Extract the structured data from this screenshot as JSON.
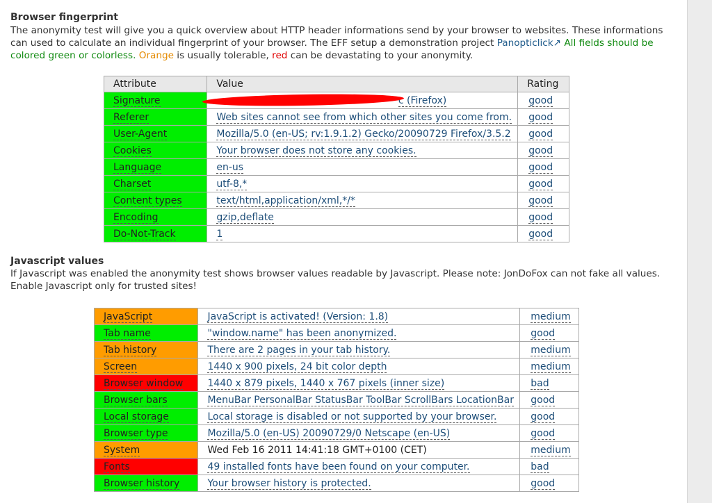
{
  "page": {
    "top_fragment": "· · · ·  ·  ·"
  },
  "fingerprint": {
    "heading": "Browser fingerprint",
    "intro_1": "The anonymity test will give you a quick overview about HTTP header informations send by your browser to websites. These informations can used to calculate an individual fingerprint of your browser. The EFF setup a demonstration project ",
    "link": "Panopticlick",
    "link_icon": "external-link-icon",
    "link_glyph": "↗",
    "intro_green": " All fields should be colored green or colorless.",
    "intro_orange": "Orange",
    "intro_mid": " is usually tolerable, ",
    "intro_red": "red",
    "intro_end": " can be devastating to your anonymity.",
    "columns": [
      "Attribute",
      "Value",
      "Rating"
    ],
    "rows": [
      {
        "attribute": "Signature",
        "value": "c (Firefox)",
        "rating": "good",
        "color": "green"
      },
      {
        "attribute": "Referer",
        "value": "Web sites cannot see from which other sites you come from.",
        "rating": "good",
        "color": "green"
      },
      {
        "attribute": "User-Agent",
        "value": "Mozilla/5.0 (en-US; rv:1.9.1.2) Gecko/20090729 Firefox/3.5.2",
        "rating": "good",
        "color": "green"
      },
      {
        "attribute": "Cookies",
        "value": "Your browser does not store any cookies.",
        "rating": "good",
        "color": "green"
      },
      {
        "attribute": "Language",
        "value": "en-us",
        "rating": "good",
        "color": "green"
      },
      {
        "attribute": "Charset",
        "value": "utf-8,*",
        "rating": "good",
        "color": "green"
      },
      {
        "attribute": "Content types",
        "value": "text/html,application/xml,*/*",
        "rating": "good",
        "color": "green"
      },
      {
        "attribute": "Encoding",
        "value": "gzip,deflate",
        "rating": "good",
        "color": "green"
      },
      {
        "attribute": "Do-Not-Track",
        "value": "1",
        "rating": "good",
        "color": "green"
      }
    ]
  },
  "javascript": {
    "heading": "Javascript values",
    "intro": "If Javascript was enabled the anonymity test shows browser values readable by Javascript. Please note: JonDoFox can not fake all values. Enable Javascript only for trusted sites!",
    "rows": [
      {
        "attribute": "JavaScript",
        "value": "JavaScript is activated! (Version: 1.8)",
        "rating": "medium",
        "color": "orange"
      },
      {
        "attribute": "Tab name",
        "value": "\"window.name\" has been anonymized.",
        "rating": "good",
        "color": "green"
      },
      {
        "attribute": "Tab history",
        "value": "There are 2 pages in your tab history.",
        "rating": "medium",
        "color": "orange"
      },
      {
        "attribute": "Screen",
        "value": "1440 x 900 pixels, 24 bit color depth",
        "rating": "medium",
        "color": "orange"
      },
      {
        "attribute": "Browser window",
        "value": "1440 x 879 pixels, 1440 x 767 pixels (inner size)",
        "rating": "bad",
        "color": "red"
      },
      {
        "attribute": "Browser bars",
        "value": "MenuBar PersonalBar StatusBar ToolBar ScrollBars LocationBar",
        "rating": "good",
        "color": "green"
      },
      {
        "attribute": "Local storage",
        "value": "Local storage is disabled or not supported by your browser.",
        "rating": "good",
        "color": "green"
      },
      {
        "attribute": "Browser type",
        "value": "Mozilla/5.0 (en-US) 20090729/0 Netscape (en-US)",
        "rating": "good",
        "color": "green"
      },
      {
        "attribute": "System",
        "value": "Wed Feb 16 2011 14:41:18 GMT+0100 (CET)",
        "rating": "medium",
        "color": "orange"
      },
      {
        "attribute": "Fonts",
        "value": "49 installed fonts have been found on your computer.",
        "rating": "bad",
        "color": "red"
      },
      {
        "attribute": "Browser history",
        "value": "Your browser history is protected.",
        "rating": "good",
        "color": "green"
      }
    ]
  },
  "colors": {
    "green": "#00ee00",
    "orange": "#ff9c00",
    "red": "#ff0000",
    "link": "#1e4e79"
  }
}
